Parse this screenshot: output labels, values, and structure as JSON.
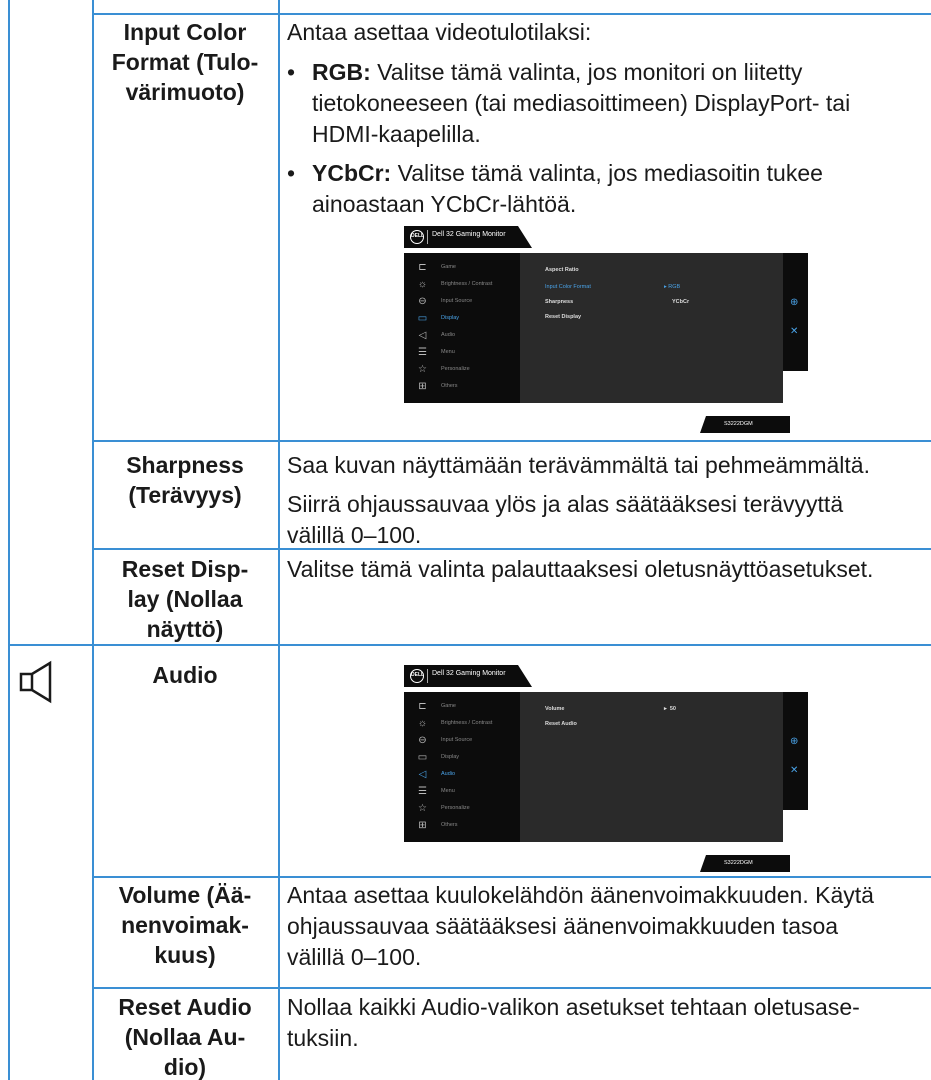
{
  "rows": {
    "input_color_format": {
      "label_lines": [
        "Input Color",
        "Format (Tulo-",
        "värimuoto)"
      ],
      "intro": "Antaa asettaa videotulotilaksi:",
      "bullet_char": "•",
      "rgb": {
        "term": "RGB:",
        "text_line1": " Valitse tämä valinta, jos monitori on liitetty",
        "text_line2": "tietokoneeseen (tai mediasoittimeen) DisplayPort- tai",
        "text_line3": "HDMI-kaapelilla."
      },
      "ycbcr": {
        "term": "YCbCr:",
        "text_line1": " Valitse tämä valinta, jos mediasoitin tukee",
        "text_line2": "ainoastaan YCbCr-lähtöä."
      }
    },
    "sharpness": {
      "label_lines": [
        "Sharpness",
        "(Terävyys)"
      ],
      "p1": "Saa kuvan näyttämään terävämmältä tai pehmeämmältä.",
      "p2_line1": "Siirrä ohjaussauvaa ylös ja alas säätääksesi terävyyttä",
      "p2_line2": "välillä 0–100."
    },
    "reset_display": {
      "label_lines": [
        "Reset Disp-",
        "lay (Nollaa",
        "näyttö)"
      ],
      "text": "Valitse tämä valinta palauttaaksesi oletusnäyttöasetukset."
    },
    "audio": {
      "label": "Audio",
      "icon": "speaker-icon"
    },
    "volume": {
      "label_lines": [
        "Volume (Ää-",
        "nenvoimak-",
        "kuus)"
      ],
      "line1": "Antaa asettaa kuulokelähdön äänenvoimakkuuden. Käytä",
      "line2": "ohjaussauvaa säätääksesi äänenvoimakkuuden tasoa",
      "line3": "välillä 0–100."
    },
    "reset_audio": {
      "label_lines": [
        "Reset Audio",
        "(Nollaa Au-",
        "dio)"
      ],
      "line1": "Nollaa kaikki Audio-valikon asetukset tehtaan oletusase-",
      "line2": "tuksiin."
    }
  },
  "osd": {
    "logo": "DELL",
    "title": "Dell 32 Gaming Monitor",
    "model": "S3222DGM",
    "menu": [
      "Game",
      "Brightness / Contrast",
      "Input Source",
      "Display",
      "Audio",
      "Menu",
      "Personalize",
      "Others"
    ],
    "menu_icons": [
      "game-icon",
      "brightness-icon",
      "input-source-icon",
      "display-icon",
      "audio-icon",
      "menu-icon",
      "personalize-icon",
      "others-icon"
    ],
    "display_screen": {
      "active_menu": "Display",
      "options": [
        "Aspect Ratio",
        "Input Color Format",
        "Sharpness",
        "Reset Display"
      ],
      "selected_option": "Input Color Format",
      "values": [
        "RGB",
        "YCbCr"
      ],
      "selected_value": "RGB"
    },
    "audio_screen": {
      "active_menu": "Audio",
      "options": [
        "Volume",
        "Reset Audio"
      ],
      "volume_value": "50"
    }
  },
  "colors": {
    "rule": "#3a8fd4",
    "accent": "#4aa3e8"
  }
}
